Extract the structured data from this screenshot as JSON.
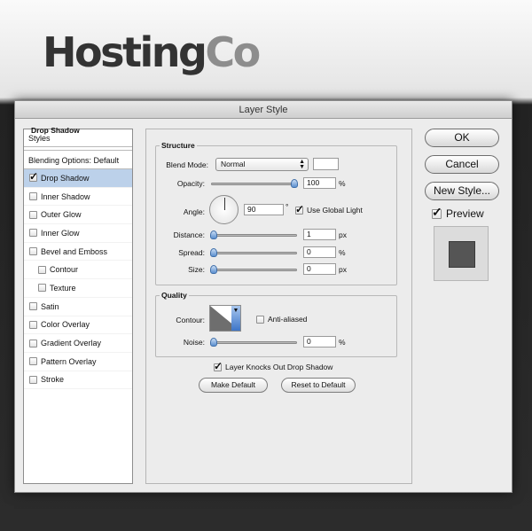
{
  "logo": {
    "part1": "Hosting",
    "part2": "Co"
  },
  "dialog": {
    "title": "Layer Style"
  },
  "styles_panel": {
    "header": "Styles",
    "blending": "Blending Options: Default",
    "items": [
      {
        "label": "Drop Shadow",
        "checked": true,
        "selected": true
      },
      {
        "label": "Inner Shadow",
        "checked": false
      },
      {
        "label": "Outer Glow",
        "checked": false
      },
      {
        "label": "Inner Glow",
        "checked": false
      },
      {
        "label": "Bevel and Emboss",
        "checked": false
      },
      {
        "label": "Contour",
        "checked": false,
        "sub": true
      },
      {
        "label": "Texture",
        "checked": false,
        "sub": true
      },
      {
        "label": "Satin",
        "checked": false
      },
      {
        "label": "Color Overlay",
        "checked": false
      },
      {
        "label": "Gradient Overlay",
        "checked": false
      },
      {
        "label": "Pattern Overlay",
        "checked": false
      },
      {
        "label": "Stroke",
        "checked": false
      }
    ]
  },
  "drop_shadow": {
    "title": "Drop Shadow",
    "structure": {
      "label": "Structure",
      "blend_mode_label": "Blend Mode:",
      "blend_mode_value": "Normal",
      "opacity_label": "Opacity:",
      "opacity_value": "100",
      "opacity_level": 1.0,
      "opacity_unit": "%",
      "angle_label": "Angle:",
      "angle_value": "90",
      "angle_unit": "°",
      "global_light_label": "Use Global Light",
      "distance_label": "Distance:",
      "distance_value": "1",
      "distance_unit": "px",
      "spread_label": "Spread:",
      "spread_value": "0",
      "spread_unit": "%",
      "size_label": "Size:",
      "size_value": "0",
      "size_unit": "px"
    },
    "quality": {
      "label": "Quality",
      "contour_label": "Contour:",
      "anti_aliased_label": "Anti-aliased",
      "noise_label": "Noise:",
      "noise_value": "0",
      "noise_unit": "%"
    },
    "knockout_label": "Layer Knocks Out Drop Shadow",
    "make_default_label": "Make Default",
    "reset_default_label": "Reset to Default"
  },
  "actions": {
    "ok_label": "OK",
    "cancel_label": "Cancel",
    "new_style_label": "New Style...",
    "preview_label": "Preview"
  },
  "colors": {
    "selection": "#bcd1ea",
    "slider_thumb": "#5b8fcf",
    "preview_square": "#555555"
  }
}
